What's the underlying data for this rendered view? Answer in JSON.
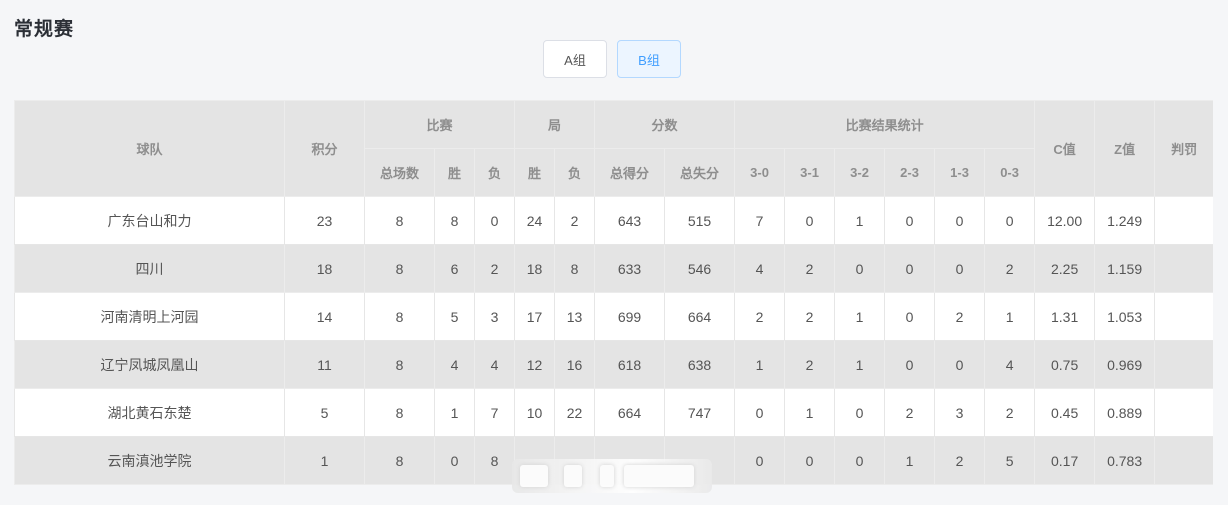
{
  "page": {
    "title": "常规赛"
  },
  "groups": [
    {
      "label": "A组",
      "active": false
    },
    {
      "label": "B组",
      "active": true
    }
  ],
  "table": {
    "headers": {
      "team": "球队",
      "points": "积分",
      "matches": "比赛",
      "sets": "局",
      "score": "分数",
      "results": "比赛结果统计",
      "c_value": "C值",
      "z_value": "Z值",
      "penalty": "判罚",
      "total_matches": "总场数",
      "win": "胜",
      "loss": "负",
      "sets_win": "胜",
      "sets_loss": "负",
      "points_for": "总得分",
      "points_against": "总失分",
      "r30": "3-0",
      "r31": "3-1",
      "r32": "3-2",
      "r23": "2-3",
      "r13": "1-3",
      "r03": "0-3"
    },
    "rows": [
      {
        "team": "广东台山和力",
        "points": "23",
        "total": "8",
        "win": "8",
        "loss": "0",
        "sw": "24",
        "sl": "2",
        "pf": "643",
        "pa": "515",
        "r30": "7",
        "r31": "0",
        "r32": "1",
        "r23": "0",
        "r13": "0",
        "r03": "0",
        "c": "12.00",
        "z": "1.249",
        "penalty": ""
      },
      {
        "team": "四川",
        "points": "18",
        "total": "8",
        "win": "6",
        "loss": "2",
        "sw": "18",
        "sl": "8",
        "pf": "633",
        "pa": "546",
        "r30": "4",
        "r31": "2",
        "r32": "0",
        "r23": "0",
        "r13": "0",
        "r03": "2",
        "c": "2.25",
        "z": "1.159",
        "penalty": ""
      },
      {
        "team": "河南清明上河园",
        "points": "14",
        "total": "8",
        "win": "5",
        "loss": "3",
        "sw": "17",
        "sl": "13",
        "pf": "699",
        "pa": "664",
        "r30": "2",
        "r31": "2",
        "r32": "1",
        "r23": "0",
        "r13": "2",
        "r03": "1",
        "c": "1.31",
        "z": "1.053",
        "penalty": ""
      },
      {
        "team": "辽宁凤城凤凰山",
        "points": "11",
        "total": "8",
        "win": "4",
        "loss": "4",
        "sw": "12",
        "sl": "16",
        "pf": "618",
        "pa": "638",
        "r30": "1",
        "r31": "2",
        "r32": "1",
        "r23": "0",
        "r13": "0",
        "r03": "4",
        "c": "0.75",
        "z": "0.969",
        "penalty": ""
      },
      {
        "team": "湖北黄石东楚",
        "points": "5",
        "total": "8",
        "win": "1",
        "loss": "7",
        "sw": "10",
        "sl": "22",
        "pf": "664",
        "pa": "747",
        "r30": "0",
        "r31": "1",
        "r32": "0",
        "r23": "2",
        "r13": "3",
        "r03": "2",
        "c": "0.45",
        "z": "0.889",
        "penalty": ""
      },
      {
        "team": "云南滇池学院",
        "points": "1",
        "total": "8",
        "win": "0",
        "loss": "8",
        "sw": "",
        "sl": "",
        "pf": "",
        "pa": "",
        "r30": "0",
        "r31": "0",
        "r32": "0",
        "r23": "1",
        "r13": "2",
        "r03": "5",
        "c": "0.17",
        "z": "0.783",
        "penalty": ""
      }
    ]
  }
}
